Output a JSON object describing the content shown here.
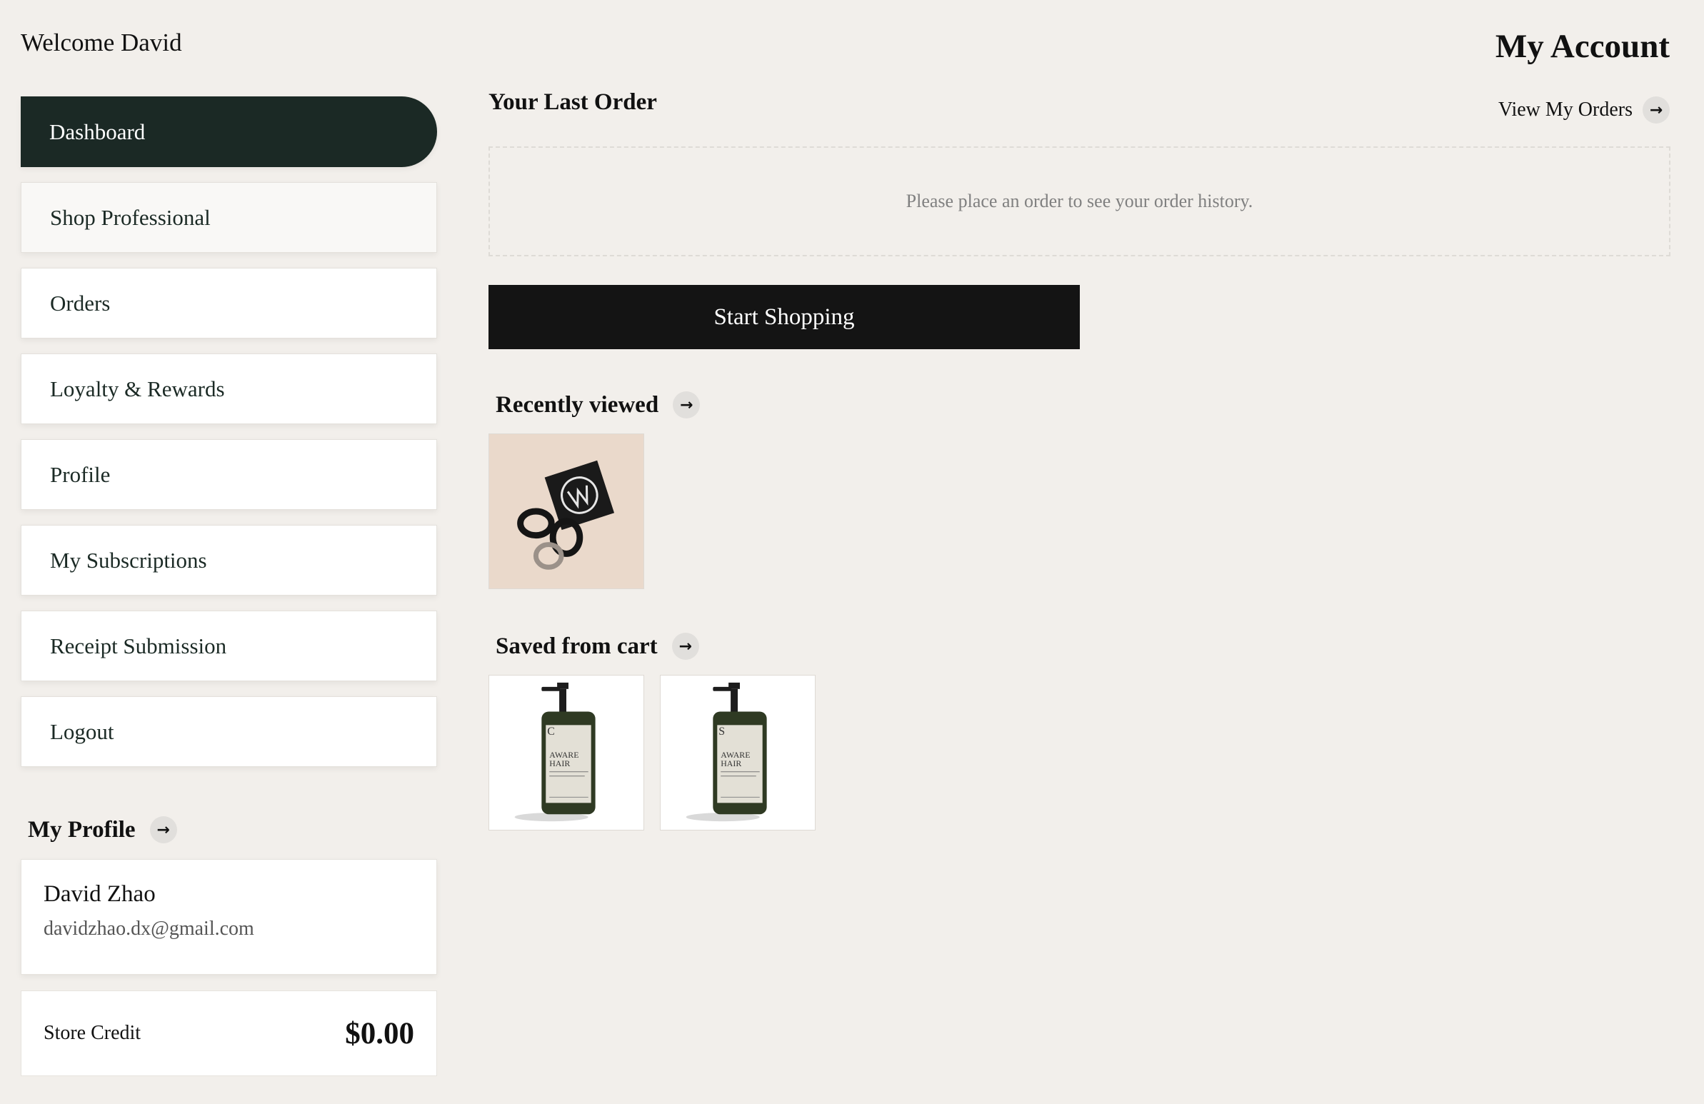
{
  "header": {
    "welcome": "Welcome David",
    "title": "My Account"
  },
  "sidebar": {
    "items": [
      {
        "label": "Dashboard",
        "active": true
      },
      {
        "label": "Shop Professional"
      },
      {
        "label": "Orders"
      },
      {
        "label": "Loyalty & Rewards"
      },
      {
        "label": "Profile"
      },
      {
        "label": "My Subscriptions"
      },
      {
        "label": "Receipt Submission"
      },
      {
        "label": "Logout"
      }
    ]
  },
  "profile": {
    "heading": "My Profile",
    "name": "David Zhao",
    "email": "davidzhao.dx@gmail.com",
    "store_credit_label": "Store Credit",
    "store_credit_value": "$0.00"
  },
  "orders": {
    "heading": "Your Last Order",
    "view_link": "View My Orders",
    "empty_message": "Please place an order to see your order history.",
    "cta": "Start Shopping"
  },
  "recently_viewed": {
    "heading": "Recently viewed",
    "items": [
      {
        "image": "hair-ties-product-image"
      }
    ]
  },
  "saved_from_cart": {
    "heading": "Saved from cart",
    "items": [
      {
        "image": "conditioner-bottle-image",
        "label_lines": [
          "C",
          "AWARE",
          "HAIR"
        ]
      },
      {
        "image": "shampoo-bottle-image",
        "label_lines": [
          "S",
          "AWARE",
          "HAIR"
        ]
      }
    ]
  },
  "icons": {
    "arrow": "→"
  },
  "colors": {
    "background": "#f2efeb",
    "active_nav": "#1b2925",
    "button": "#141414"
  }
}
